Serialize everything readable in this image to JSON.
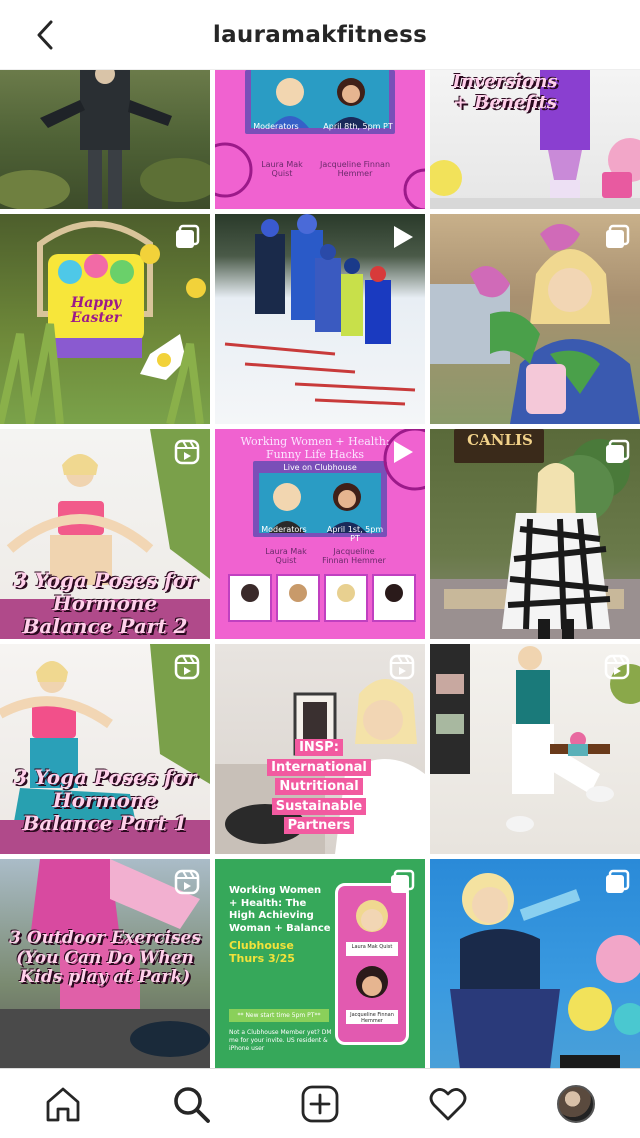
{
  "header": {
    "username": "lauramakfitness",
    "back_icon": "chevron-left-icon"
  },
  "posts": {
    "p1": {},
    "p2": {
      "moderators": "Moderators",
      "date": "April 8th, 5pm PT",
      "host1": "Laura Mak Quist",
      "host2": "Jacqueline Finnan Hemmer"
    },
    "p3": {
      "overlay": "Inversions + Benefits"
    },
    "p4": {
      "sign": "Happy Easter"
    },
    "p5": {},
    "p6": {},
    "p7": {
      "overlay": "3 Yoga Poses for Hormone Balance Part 2"
    },
    "p8": {
      "title": "Working Women + Health: Funny Life Hacks",
      "subtitle": "Live on Clubhouse",
      "moderators": "Moderators",
      "date": "April 1st, 5pm PT",
      "host1": "Laura Mak Quist",
      "host2": "Jacqueline Finnan Hemmer"
    },
    "p9": {
      "sign": "CANLIS"
    },
    "p10": {
      "overlay": "3 Yoga Poses for Hormone Balance Part 1"
    },
    "p11": {
      "line1": "INSP:",
      "line2": "International",
      "line3": "Nutritional",
      "line4": "Sustainable",
      "line5": "Partners"
    },
    "p12": {},
    "p13": {
      "overlay": "3 Outdoor Exercises (You Can Do When Kids play at Park)"
    },
    "p14": {
      "title": "Working Women + Health: The High Achieving Woman + Balance",
      "event": "Clubhouse Thurs 3/25",
      "note": "** New start time 5pm PT**",
      "cta": "Not a Clubhouse Member yet? DM me for your invite. US resident & iPhone user",
      "card1": "Laura Mak Quist",
      "card2": "Jacqueline Finnan Hemmer"
    },
    "p15": {}
  },
  "tabbar": {
    "home_icon": "home-icon",
    "search_icon": "search-icon",
    "add_icon": "add-post-icon",
    "activity_icon": "heart-icon",
    "profile_icon": "profile-avatar"
  }
}
